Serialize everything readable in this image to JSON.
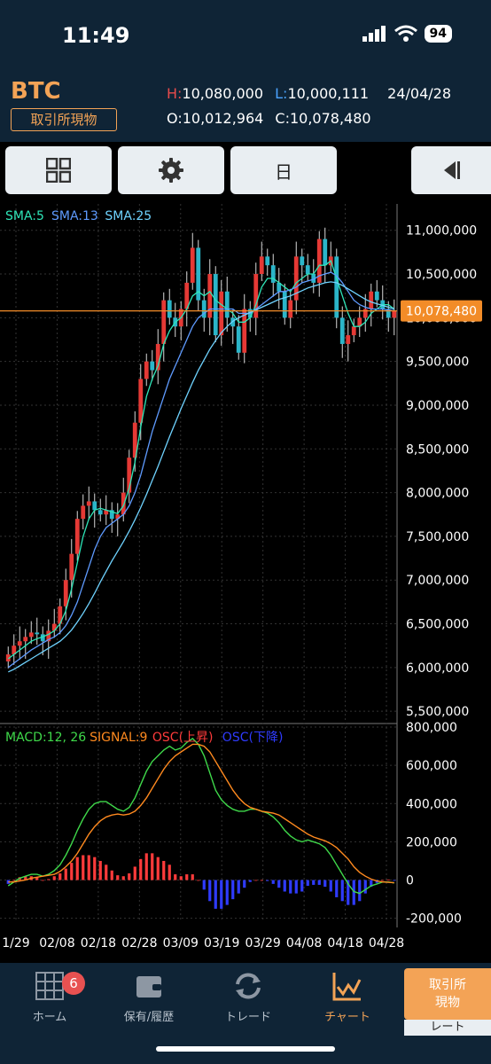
{
  "status": {
    "time": "11:49",
    "battery": "94"
  },
  "header": {
    "symbol": "BTC",
    "market": "取引所現物",
    "h_label": "H:",
    "high": "10,080,000",
    "l_label": "L:",
    "low": "10,000,111",
    "date": "24/04/28",
    "o_label": "O:",
    "open": "10,012,964",
    "c_label": "C:",
    "close": "10,078,480"
  },
  "toolbar": {
    "period_label": "日"
  },
  "chart_data": [
    {
      "type": "line",
      "subtype": "candlestick",
      "legend": [
        {
          "name": "SMA:5",
          "color": "#2ee6b8"
        },
        {
          "name": "SMA:13",
          "color": "#5f9bff"
        },
        {
          "name": "SMA:25",
          "color": "#6fd3ff"
        }
      ],
      "ylim": [
        5400000,
        11200000
      ],
      "y_ticks": [
        "11,000,000",
        "10,500,000",
        "10,000,000",
        "9,500,000",
        "9,000,000",
        "8,500,000",
        "8,000,000",
        "7,500,000",
        "7,000,000",
        "6,500,000",
        "6,000,000",
        "5,500,000"
      ],
      "y_tick_values": [
        11000000,
        10500000,
        10000000,
        9500000,
        9000000,
        8500000,
        8000000,
        7500000,
        7000000,
        6500000,
        6000000,
        5500000
      ],
      "current_price_label": "10,078,480",
      "current_price": 10078480,
      "x_tick_labels": [
        "1/29",
        "02/08",
        "02/18",
        "02/28",
        "03/09",
        "03/19",
        "03/29",
        "04/08",
        "04/18",
        "04/28"
      ],
      "closes": [
        6150000,
        6250000,
        6300000,
        6350000,
        6400000,
        6380000,
        6300000,
        6420000,
        6500000,
        6700000,
        7000000,
        7300000,
        7700000,
        7850000,
        7900000,
        7800000,
        7750000,
        7800000,
        7700000,
        7750000,
        8000000,
        8400000,
        8800000,
        9300000,
        9500000,
        9400000,
        9700000,
        10200000,
        10000000,
        9900000,
        10100000,
        10400000,
        10800000,
        10200000,
        10000000,
        10500000,
        9800000,
        10300000,
        10000000,
        9900000,
        9600000,
        10100000,
        10000000,
        10500000,
        10700000,
        10600000,
        10400000,
        10300000,
        10000000,
        10200000,
        10700000,
        10600000,
        10500000,
        10400000,
        10900000,
        10600000,
        10700000,
        10000000,
        9700000,
        9800000,
        9900000,
        10000000,
        10100000,
        10300000,
        10200000,
        10100000,
        10000000,
        10078480
      ],
      "sma5": [
        6100000,
        6150000,
        6200000,
        6250000,
        6300000,
        6330000,
        6350000,
        6380000,
        6420000,
        6500000,
        6650000,
        6900000,
        7200000,
        7500000,
        7700000,
        7800000,
        7820000,
        7800000,
        7780000,
        7760000,
        7850000,
        8050000,
        8350000,
        8750000,
        9100000,
        9300000,
        9450000,
        9700000,
        9850000,
        9950000,
        10000000,
        10100000,
        10250000,
        10300000,
        10250000,
        10300000,
        10200000,
        10150000,
        10100000,
        10050000,
        9950000,
        9950000,
        10000000,
        10150000,
        10350000,
        10450000,
        10450000,
        10400000,
        10350000,
        10300000,
        10400000,
        10450000,
        10500000,
        10500000,
        10600000,
        10600000,
        10650000,
        10450000,
        10250000,
        10050000,
        9900000,
        9900000,
        9950000,
        10050000,
        10100000,
        10150000,
        10150000,
        10100000
      ],
      "sma13": [
        6000000,
        6050000,
        6100000,
        6150000,
        6200000,
        6240000,
        6280000,
        6320000,
        6350000,
        6400000,
        6480000,
        6600000,
        6750000,
        6950000,
        7150000,
        7350000,
        7500000,
        7600000,
        7650000,
        7700000,
        7750000,
        7850000,
        8000000,
        8200000,
        8450000,
        8700000,
        8900000,
        9100000,
        9300000,
        9450000,
        9600000,
        9750000,
        9900000,
        10000000,
        10050000,
        10100000,
        10100000,
        10100000,
        10100000,
        10100000,
        10050000,
        10050000,
        10050000,
        10100000,
        10150000,
        10200000,
        10250000,
        10300000,
        10300000,
        10320000,
        10350000,
        10400000,
        10420000,
        10440000,
        10480000,
        10500000,
        10520000,
        10480000,
        10400000,
        10300000,
        10200000,
        10150000,
        10120000,
        10100000,
        10100000,
        10100000,
        10090000,
        10080000
      ],
      "sma25": [
        5950000,
        5980000,
        6020000,
        6060000,
        6100000,
        6140000,
        6180000,
        6220000,
        6260000,
        6300000,
        6360000,
        6430000,
        6520000,
        6620000,
        6730000,
        6850000,
        6980000,
        7100000,
        7220000,
        7330000,
        7440000,
        7560000,
        7690000,
        7830000,
        7980000,
        8140000,
        8300000,
        8470000,
        8640000,
        8800000,
        8960000,
        9110000,
        9260000,
        9400000,
        9520000,
        9640000,
        9740000,
        9830000,
        9900000,
        9960000,
        10000000,
        10030000,
        10060000,
        10090000,
        10120000,
        10150000,
        10180000,
        10210000,
        10230000,
        10250000,
        10280000,
        10310000,
        10340000,
        10360000,
        10380000,
        10400000,
        10410000,
        10400000,
        10370000,
        10330000,
        10290000,
        10250000,
        10210000,
        10180000,
        10160000,
        10140000,
        10120000,
        10100000
      ]
    },
    {
      "type": "line",
      "subtype": "macd",
      "legend": [
        {
          "name": "MACD:12, 26",
          "color": "#3fd94a"
        },
        {
          "name": "SIGNAL:9",
          "color": "#ff8a1f"
        },
        {
          "name": "OSC(上昇)",
          "color": "#ff3b3b"
        },
        {
          "name": "OSC(下降)",
          "color": "#2f3bff"
        }
      ],
      "ylim": [
        -220000,
        800000
      ],
      "y_ticks": [
        "800,000",
        "600,000",
        "400,000",
        "200,000",
        "0",
        "-200,000"
      ],
      "y_tick_values": [
        800000,
        600000,
        400000,
        200000,
        0,
        -200000
      ],
      "macd": [
        -30000,
        -10000,
        10000,
        20000,
        30000,
        30000,
        20000,
        30000,
        50000,
        80000,
        130000,
        190000,
        260000,
        320000,
        370000,
        400000,
        410000,
        410000,
        390000,
        370000,
        360000,
        380000,
        430000,
        500000,
        570000,
        620000,
        650000,
        680000,
        700000,
        680000,
        690000,
        720000,
        740000,
        710000,
        650000,
        560000,
        470000,
        420000,
        390000,
        370000,
        360000,
        360000,
        370000,
        370000,
        360000,
        350000,
        330000,
        300000,
        260000,
        230000,
        210000,
        200000,
        210000,
        200000,
        190000,
        170000,
        130000,
        80000,
        30000,
        -20000,
        -60000,
        -70000,
        -50000,
        -30000,
        -20000,
        -10000,
        -10000,
        -15000
      ],
      "signal": [
        -10000,
        -10000,
        -5000,
        0,
        10000,
        15000,
        20000,
        25000,
        30000,
        45000,
        70000,
        100000,
        140000,
        190000,
        240000,
        280000,
        310000,
        330000,
        340000,
        345000,
        340000,
        345000,
        360000,
        390000,
        430000,
        480000,
        530000,
        580000,
        620000,
        650000,
        670000,
        690000,
        710000,
        710000,
        700000,
        670000,
        620000,
        570000,
        520000,
        470000,
        430000,
        400000,
        380000,
        370000,
        360000,
        355000,
        350000,
        340000,
        320000,
        300000,
        280000,
        260000,
        240000,
        225000,
        215000,
        205000,
        190000,
        170000,
        140000,
        110000,
        70000,
        40000,
        20000,
        5000,
        -5000,
        -10000,
        -12000,
        -14000
      ],
      "osc": [
        -20000,
        0,
        15000,
        20000,
        20000,
        15000,
        0,
        5000,
        20000,
        35000,
        60000,
        90000,
        120000,
        130000,
        130000,
        120000,
        100000,
        80000,
        50000,
        25000,
        20000,
        35000,
        70000,
        110000,
        140000,
        140000,
        120000,
        100000,
        80000,
        30000,
        20000,
        30000,
        30000,
        0,
        -50000,
        -110000,
        -150000,
        -150000,
        -130000,
        -100000,
        -70000,
        -40000,
        -10000,
        0,
        0,
        -5000,
        -20000,
        -40000,
        -60000,
        -70000,
        -70000,
        -60000,
        -30000,
        -25000,
        -25000,
        -35000,
        -60000,
        -90000,
        -110000,
        -130000,
        -130000,
        -110000,
        -70000,
        -35000,
        -15000,
        0,
        2000,
        -1000
      ]
    }
  ],
  "tabs": [
    {
      "label": "ホーム",
      "badge": "6"
    },
    {
      "label": "保有/履歴"
    },
    {
      "label": "トレード"
    },
    {
      "label": "チャート"
    }
  ],
  "rate_button": {
    "line1": "取引所",
    "line2": "現物",
    "sub": "レート"
  }
}
